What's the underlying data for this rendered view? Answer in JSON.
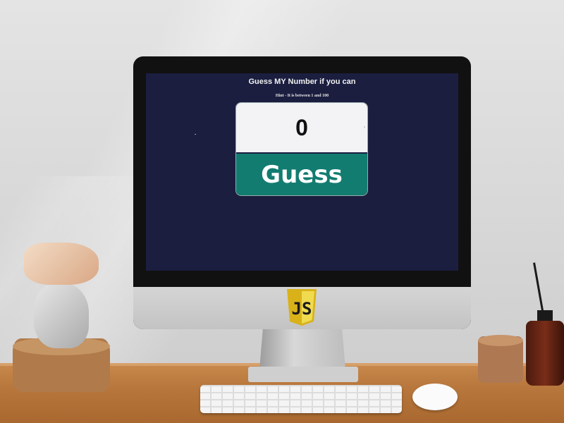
{
  "game": {
    "title": "Guess MY Number if you can",
    "hint": "Hint - It is between 1 and 100",
    "input_value": "0",
    "button_label": "Guess"
  },
  "logo": {
    "text": "JS",
    "color": "#f0db4f"
  },
  "colors": {
    "screen_bg": "#1b1e3f",
    "button_bg": "#137c71",
    "input_bg": "#f3f3f6"
  }
}
